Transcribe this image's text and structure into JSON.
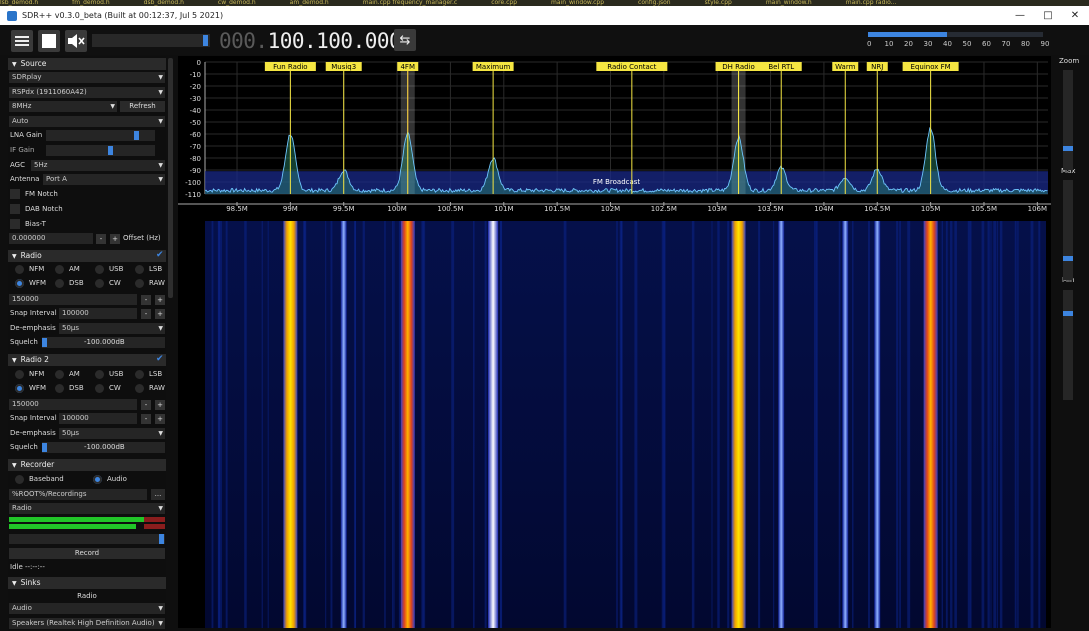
{
  "ide_tabs": [
    "lsb_demod.h",
    "fm_demod.h",
    "dsb_demod.h",
    "cw_demod.h",
    "am_demod.h",
    "main.cpp  frequency_manager.c",
    "core.cpp",
    "main_window.cpp",
    "config.json",
    "style.cpp",
    "main_window.h",
    "main.cpp  radio..."
  ],
  "window": {
    "title": "SDR++ v0.3.0_beta (Built at 00:12:37, Jul  5 2021)",
    "minimize": "—",
    "maximize": "□",
    "close": "✕"
  },
  "toolbar": {
    "freq_dim": "000.",
    "freq_bright": "100.100.000",
    "swap_icon": "⇆",
    "snr_ticks": [
      "0",
      "10",
      "20",
      "30",
      "40",
      "50",
      "60",
      "70",
      "80",
      "90"
    ],
    "snr_level": 0.45,
    "volume_level": 0.95
  },
  "source": {
    "header": "Source",
    "device": "SDRplay",
    "serial": "RSPdx (1911060A42)",
    "samplerate": "8MHz",
    "refresh": "Refresh",
    "mode": "Auto",
    "lna_label": "LNA Gain",
    "lna_level": 0.85,
    "if_label": "IF Gain",
    "if_level": 0.6,
    "agc_label": "AGC",
    "agc_value": "5Hz",
    "antenna_label": "Antenna",
    "antenna_value": "Port A",
    "fm_notch": "FM Notch",
    "dab_notch": "DAB Notch",
    "bias_t": "Bias-T",
    "offset_value": "0.000000",
    "offset_label": "Offset (Hz)"
  },
  "radio1": {
    "header": "Radio",
    "modes": [
      "NFM",
      "AM",
      "USB",
      "LSB",
      "WFM",
      "DSB",
      "CW",
      "RAW"
    ],
    "selected": "WFM",
    "bandwidth": "150000",
    "snap_label": "Snap Interval",
    "snap_value": "100000",
    "deemph_label": "De-emphasis",
    "deemph_value": "50µs",
    "squelch_label": "Squelch",
    "squelch_value": "-100.000dB"
  },
  "radio2": {
    "header": "Radio 2",
    "modes": [
      "NFM",
      "AM",
      "USB",
      "LSB",
      "WFM",
      "DSB",
      "CW",
      "RAW"
    ],
    "selected": "WFM",
    "bandwidth": "150000",
    "snap_label": "Snap Interval",
    "snap_value": "100000",
    "deemph_label": "De-emphasis",
    "deemph_value": "50µs",
    "squelch_label": "Squelch",
    "squelch_value": "-100.000dB"
  },
  "recorder": {
    "header": "Recorder",
    "baseband": "Baseband",
    "audio": "Audio",
    "path": "%ROOT%/Recordings",
    "browse": "...",
    "stream": "Radio",
    "record": "Record",
    "status": "Idle --:--:--"
  },
  "sinks": {
    "header": "Sinks",
    "title": "Radio",
    "type": "Audio",
    "device": "Speakers (Realtek High Definition Audio)"
  },
  "right_panel": {
    "zoom": "Zoom",
    "max": "Max",
    "min": "Min"
  },
  "spectrum": {
    "y_ticks": [
      "0",
      "-10",
      "-20",
      "-30",
      "-40",
      "-50",
      "-60",
      "-70",
      "-80",
      "-90",
      "-100",
      "-110"
    ],
    "x_ticks": [
      "98.5M",
      "99M",
      "99.5M",
      "100M",
      "100.5M",
      "101M",
      "101.5M",
      "102M",
      "102.5M",
      "103M",
      "103.5M",
      "104M",
      "104.5M",
      "105M",
      "105.5M",
      "106M"
    ],
    "band_label": "FM Broadcast",
    "markers": [
      {
        "name": "Fun Radio",
        "freq": 99.0
      },
      {
        "name": "Musiq3",
        "freq": 99.5
      },
      {
        "name": "4FM",
        "freq": 100.1
      },
      {
        "name": "Maximum",
        "freq": 100.9
      },
      {
        "name": "Radio Contact",
        "freq": 102.2
      },
      {
        "name": "DH Radio",
        "freq": 103.2
      },
      {
        "name": "Bel RTL",
        "freq": 103.6
      },
      {
        "name": "Warm",
        "freq": 104.2
      },
      {
        "name": "NRJ",
        "freq": 104.5
      },
      {
        "name": "Equinox FM",
        "freq": 105.0
      }
    ],
    "peaks": [
      {
        "freq": 99.0,
        "db": -60
      },
      {
        "freq": 99.5,
        "db": -90
      },
      {
        "freq": 100.1,
        "db": -60
      },
      {
        "freq": 100.9,
        "db": -80
      },
      {
        "freq": 103.2,
        "db": -63
      },
      {
        "freq": 103.6,
        "db": -88
      },
      {
        "freq": 104.2,
        "db": -96
      },
      {
        "freq": 104.5,
        "db": -89
      },
      {
        "freq": 105.0,
        "db": -55
      }
    ]
  },
  "colors": {
    "accent": "#3d85e0",
    "marker": "#f5e642",
    "vfo_red": "#d03030"
  }
}
